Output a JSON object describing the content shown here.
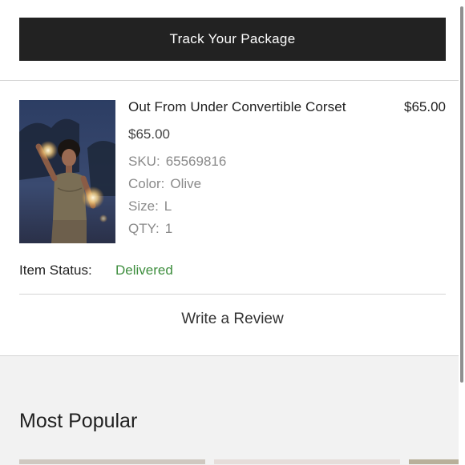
{
  "header": {
    "track_label": "Track Your Package"
  },
  "order_item": {
    "title": "Out From Under Convertible Corset",
    "price_right": "$65.00",
    "price": "$65.00",
    "sku_label": "SKU:",
    "sku_value": "65569816",
    "color_label": "Color:",
    "color_value": "Olive",
    "size_label": "Size:",
    "size_value": "L",
    "qty_label": "QTY:",
    "qty_value": "1",
    "status_label": "Item Status:",
    "status_value": "Delivered"
  },
  "review": {
    "label": "Write a Review"
  },
  "popular": {
    "heading": "Most Popular"
  },
  "colors": {
    "button_bg": "#222222",
    "status_green": "#3e8e3e",
    "section_gray": "#f2f2f2"
  }
}
